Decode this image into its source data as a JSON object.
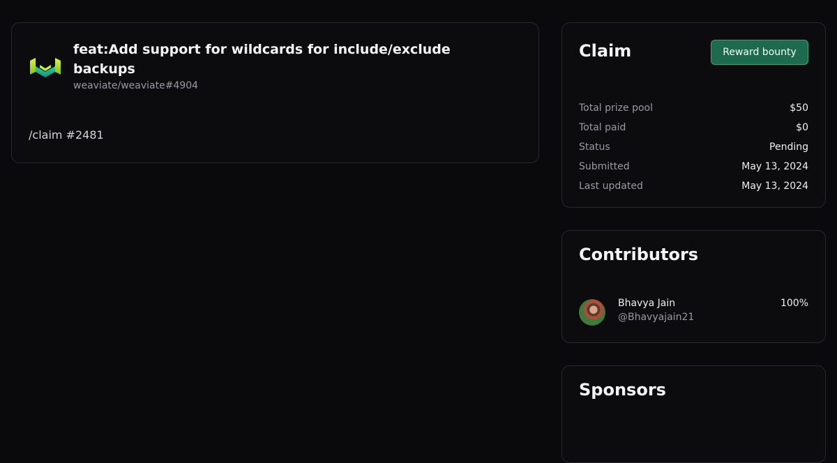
{
  "issue": {
    "title": "feat:Add support for wildcards for include/exclude backups",
    "repo_ref": "weaviate/weaviate#4904",
    "body": "/claim #2481"
  },
  "claim": {
    "heading": "Claim",
    "reward_button": "Reward bounty",
    "stats": [
      {
        "label": "Total prize pool",
        "value": "$50"
      },
      {
        "label": "Total paid",
        "value": "$0"
      },
      {
        "label": "Status",
        "value": "Pending"
      },
      {
        "label": "Submitted",
        "value": "May 13, 2024"
      },
      {
        "label": "Last updated",
        "value": "May 13, 2024"
      }
    ]
  },
  "contributors": {
    "heading": "Contributors",
    "items": [
      {
        "name": "Bhavya Jain",
        "handle": "@Bhavyajain21",
        "share": "100%"
      }
    ]
  },
  "sponsors": {
    "heading": "Sponsors"
  },
  "colors": {
    "background": "#0a0a0c",
    "accent_button": "#1d6a4f"
  }
}
